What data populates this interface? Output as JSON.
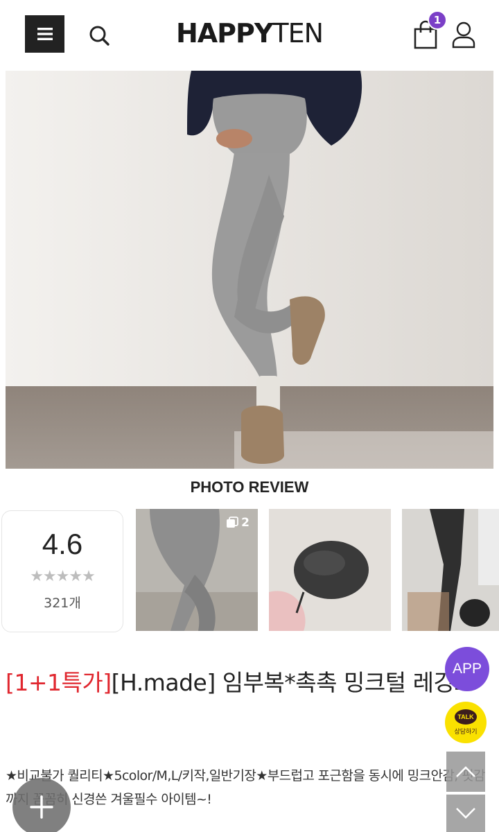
{
  "header": {
    "logo_bold": "HAPPY",
    "logo_light": "TEN",
    "cart_count": "1",
    "icons": [
      "menu-icon",
      "search-icon",
      "shopping-bag-icon",
      "user-icon"
    ]
  },
  "colors": {
    "accent": "#7b3fc7",
    "promo_red": "#e0262e",
    "app_button": "#7c4ddb",
    "kakao_yellow": "#fae100"
  },
  "review": {
    "heading": "PHOTO REVIEW",
    "rating": "4.6",
    "stars": "★★★★★",
    "count": "321개",
    "thumbs": [
      {
        "count": "2"
      },
      {
        "count": ""
      },
      {
        "count": ""
      }
    ]
  },
  "product": {
    "title_promo": "[1+1특가]",
    "title_main": "[H.made] 임부복*촉촉 밍크털 레깅스",
    "description": "★비교불가 퀄리티★5color/M,L/키작,일반기장★부드럽고 포근함을 동시에 밍크안감, 핏감까지 꼼꼼히 신경쓴 겨울필수 아이템~!"
  },
  "floating": {
    "app_label": "APP",
    "talk_label": "TALK",
    "talk_sub": "상담하기"
  }
}
